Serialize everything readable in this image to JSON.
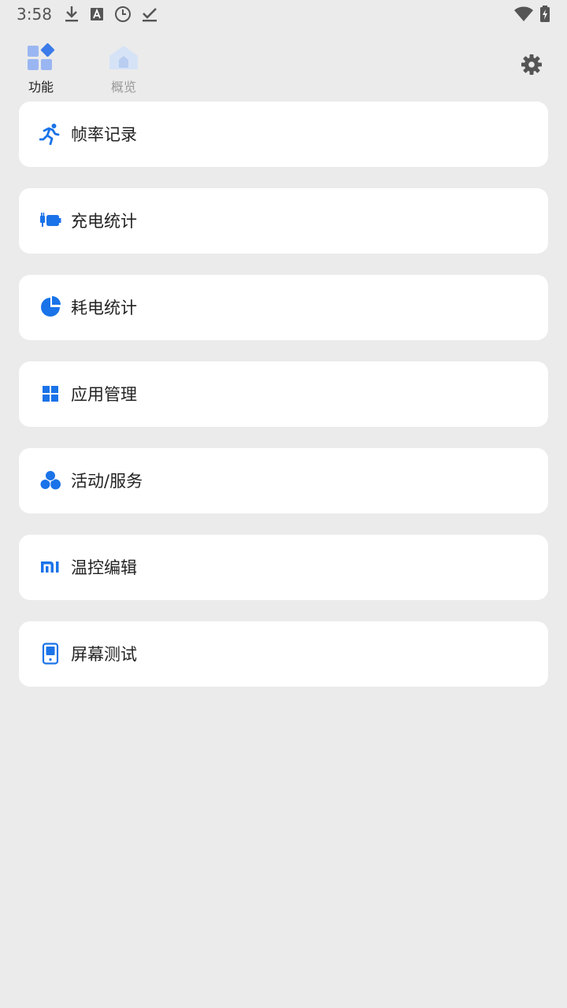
{
  "status_bar": {
    "time": "3:58",
    "left_icons": [
      "download-icon",
      "text-a-icon",
      "clock-icon",
      "check-icon"
    ],
    "right_icons": [
      "wifi-icon",
      "battery-charging-icon"
    ]
  },
  "top_nav": {
    "tabs": [
      {
        "label": "功能",
        "icon": "grid-diamond-icon",
        "active": true
      },
      {
        "label": "概览",
        "icon": "home-icon",
        "active": false
      }
    ],
    "settings_icon": "gear-icon"
  },
  "menu": {
    "items": [
      {
        "label": "帧率记录",
        "icon": "running-icon"
      },
      {
        "label": "充电统计",
        "icon": "plug-battery-icon"
      },
      {
        "label": "耗电统计",
        "icon": "pie-chart-icon"
      },
      {
        "label": "应用管理",
        "icon": "apps-grid-icon"
      },
      {
        "label": "活动/服务",
        "icon": "three-circles-icon"
      },
      {
        "label": "温控编辑",
        "icon": "mi-logo-icon"
      },
      {
        "label": "屏幕测试",
        "icon": "phone-screen-icon"
      }
    ]
  },
  "colors": {
    "accent": "#1a73e8",
    "background": "#ebebeb",
    "card": "#ffffff"
  }
}
